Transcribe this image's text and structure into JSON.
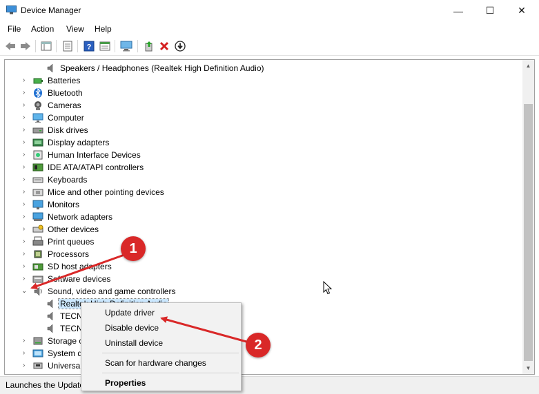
{
  "window": {
    "title": "Device Manager",
    "controls": {
      "minimize": "—",
      "maximize": "☐",
      "close": "✕"
    }
  },
  "menu": [
    "File",
    "Action",
    "View",
    "Help"
  ],
  "toolbar": {
    "buttons": [
      "back-icon",
      "forward-icon",
      "show-hide-tree-icon",
      "properties-icon",
      "help-icon",
      "view-icon",
      "computer-icon",
      "update-driver-icon",
      "uninstall-icon",
      "enable-device-icon"
    ]
  },
  "tree": {
    "top_item": "Speakers / Headphones (Realtek High Definition Audio)",
    "categories": [
      "Batteries",
      "Bluetooth",
      "Cameras",
      "Computer",
      "Disk drives",
      "Display adapters",
      "Human Interface Devices",
      "IDE ATA/ATAPI controllers",
      "Keyboards",
      "Mice and other pointing devices",
      "Monitors",
      "Network adapters",
      "Other devices",
      "Print queues",
      "Processors",
      "SD host adapters",
      "Software devices"
    ],
    "expanded_category": "Sound, video and game controllers",
    "children": [
      "Realtek High Definition Audio",
      "TECN",
      "TECN"
    ],
    "after_categories": [
      "Storage c",
      "System d",
      "Universal"
    ]
  },
  "status": {
    "text": "Launches the Update"
  },
  "context_menu": {
    "items": [
      "Update driver",
      "Disable device",
      "Uninstall device",
      "Scan for hardware changes",
      "Properties"
    ]
  },
  "callouts": {
    "first": "1",
    "second": "2"
  },
  "colors": {
    "accent_red": "#d92828",
    "selection": "#cce8ff"
  }
}
